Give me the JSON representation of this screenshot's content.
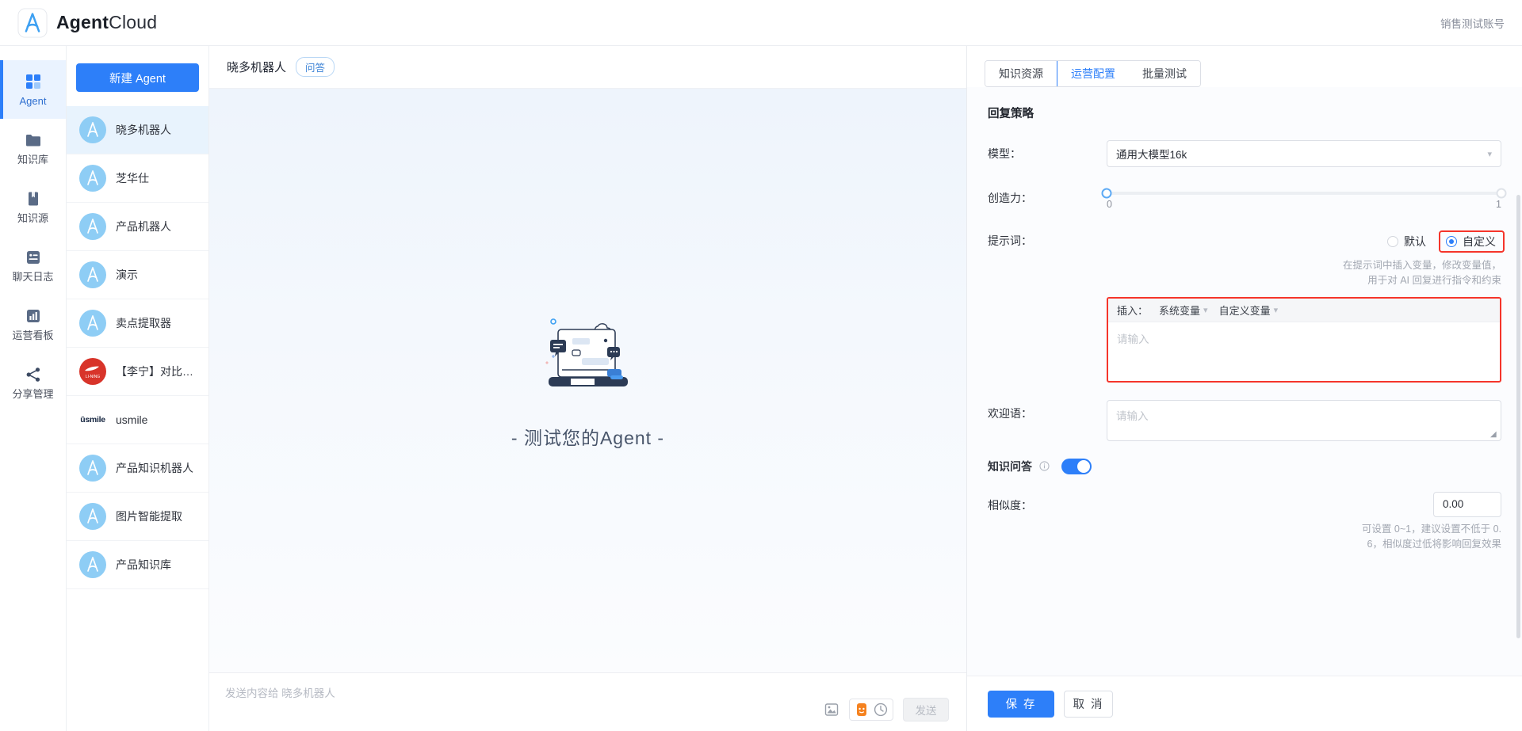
{
  "header": {
    "brand_bold": "Agent",
    "brand_light": "Cloud",
    "logo_icon": "agent-cloud-logo",
    "account": "销售测试账号"
  },
  "rail": {
    "items": [
      {
        "label": "Agent",
        "icon": "grid-icon",
        "active": true
      },
      {
        "label": "知识库",
        "icon": "folder-icon",
        "active": false
      },
      {
        "label": "知识源",
        "icon": "book-icon",
        "active": false
      },
      {
        "label": "聊天日志",
        "icon": "chat-log-icon",
        "active": false
      },
      {
        "label": "运营看板",
        "icon": "bar-chart-icon",
        "active": false
      },
      {
        "label": "分享管理",
        "icon": "share-icon",
        "active": false
      }
    ]
  },
  "agent_panel": {
    "new_agent_label": "新建 Agent",
    "items": [
      {
        "name": "晓多机器人",
        "avatar": "agent-default-avatar",
        "active": true
      },
      {
        "name": "芝华仕",
        "avatar": "agent-default-avatar",
        "active": false
      },
      {
        "name": "产品机器人",
        "avatar": "agent-default-avatar",
        "active": false
      },
      {
        "name": "演示",
        "avatar": "agent-default-avatar",
        "active": false
      },
      {
        "name": "卖点提取器",
        "avatar": "agent-default-avatar",
        "active": false
      },
      {
        "name": "【李宁】对比话术...",
        "avatar": "lining-brand-avatar",
        "active": false
      },
      {
        "name": "usmile",
        "avatar": "usmile-brand-avatar",
        "active": false
      },
      {
        "name": "产品知识机器人",
        "avatar": "agent-default-avatar",
        "active": false
      },
      {
        "name": "图片智能提取",
        "avatar": "agent-default-avatar",
        "active": false
      },
      {
        "name": "产品知识库",
        "avatar": "agent-default-avatar",
        "active": false
      }
    ]
  },
  "chat": {
    "title": "晓多机器人",
    "tag": "问答",
    "empty_illustration": "laptop-chat-illustration",
    "empty_text": "- 测试您的Agent -",
    "input_placeholder": "发送内容给 晓多机器人",
    "tools": [
      {
        "icon": "image-upload-icon"
      },
      {
        "icon": "emoji-icon"
      },
      {
        "icon": "sticker-icon"
      }
    ],
    "send_label": "发送"
  },
  "config": {
    "tabs": [
      {
        "label": "知识资源",
        "active": false
      },
      {
        "label": "运营配置",
        "active": true
      },
      {
        "label": "批量测试",
        "active": false
      }
    ],
    "section_title": "回复策略",
    "model": {
      "label": "模型：",
      "value": "通用大模型16k",
      "chevron_icon": "chevron-down-icon"
    },
    "creativity": {
      "label": "创造力：",
      "value": 0,
      "min_label": "0",
      "max_label": "1"
    },
    "prompt": {
      "label": "提示词：",
      "options": [
        {
          "label": "默认",
          "checked": false,
          "highlighted": false
        },
        {
          "label": "自定义",
          "checked": true,
          "highlighted": true
        }
      ],
      "hint_line1": "在提示词中插入变量，修改变量值，",
      "hint_line2": "用于对 AI 回复进行指令和约束",
      "toolbar_prefix": "插入：",
      "toolbar_items": [
        {
          "label": "系统变量",
          "chevron_icon": "chevron-down-icon"
        },
        {
          "label": "自定义变量",
          "chevron_icon": "chevron-down-icon"
        }
      ],
      "placeholder": "请输入",
      "highlight_color": "#f5352b"
    },
    "welcome": {
      "label": "欢迎语：",
      "placeholder": "请输入",
      "resize_icon": "resize-grip-icon"
    },
    "knowledge_qa": {
      "label": "知识问答",
      "info_icon": "info-circle-icon",
      "enabled": true
    },
    "similarity": {
      "label": "相似度：",
      "value": "0.00",
      "hint_line1": "可设置 0~1，建议设置不低于 0.",
      "hint_line2": "6，相似度过低将影响回复效果"
    },
    "footer": {
      "save_label": "保 存",
      "cancel_label": "取 消"
    },
    "accent_color": "#2d7ff9"
  }
}
